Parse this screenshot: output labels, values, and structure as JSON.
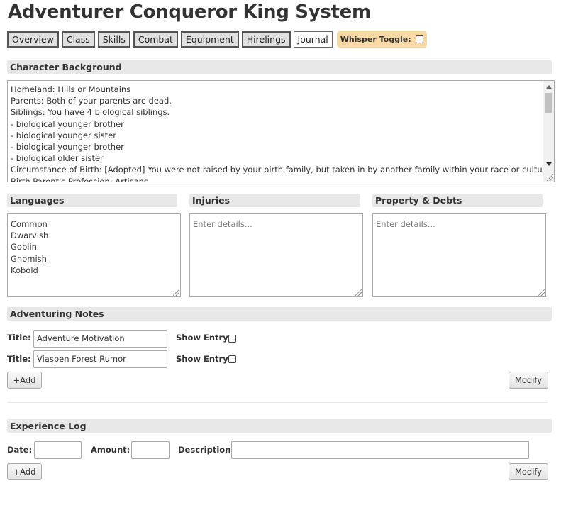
{
  "app": {
    "title": "Adventurer Conqueror King System"
  },
  "tabs": [
    {
      "label": "Overview"
    },
    {
      "label": "Class"
    },
    {
      "label": "Skills"
    },
    {
      "label": "Combat"
    },
    {
      "label": "Equipment"
    },
    {
      "label": "Hirelings"
    },
    {
      "label": "Journal",
      "active": true
    }
  ],
  "whisper": {
    "label": "Whisper Toggle:",
    "checked": false
  },
  "background": {
    "header": "Character Background",
    "lines": [
      "Homeland: Hills or Mountains",
      "Parents: Both of your parents are dead.",
      "Siblings: You have 4 biological siblings.",
      "- biological younger brother",
      "- biological younger sister",
      "- biological younger brother",
      "- biological older sister",
      "Circumstance of Birth: [Adopted] You were not raised by your birth family, but taken in by another family within your race or culture.",
      "Birth Parent's Profession: Artisans"
    ]
  },
  "languages": {
    "header": "Languages",
    "lines": [
      "Common",
      "Dwarvish",
      "Goblin",
      "Gnomish",
      "Kobold"
    ]
  },
  "injuries": {
    "header": "Injuries",
    "placeholder": "Enter details..."
  },
  "property": {
    "header": "Property & Debts",
    "placeholder": "Enter details..."
  },
  "notes": {
    "header": "Adventuring Notes",
    "title_label": "Title:",
    "show_label": "Show Entry:",
    "entries": [
      {
        "title": "Adventure Motivation",
        "show": false
      },
      {
        "title": "Viaspen Forest Rumor",
        "show": false
      }
    ],
    "add_label": "+Add",
    "modify_label": "Modify"
  },
  "xp": {
    "header": "Experience Log",
    "date_label": "Date:",
    "amount_label": "Amount:",
    "desc_label": "Description:",
    "date_value": "",
    "amount_value": "",
    "desc_value": "",
    "add_label": "+Add",
    "modify_label": "Modify"
  }
}
